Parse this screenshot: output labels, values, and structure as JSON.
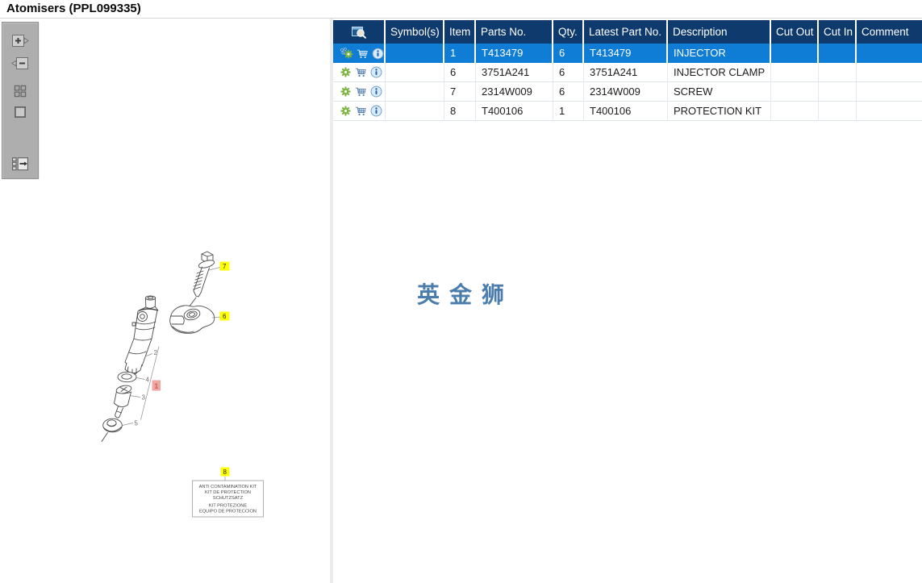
{
  "window": {
    "title": "Atomisers (PPL099335)"
  },
  "toolbar": {
    "buttons": [
      "zoom-in",
      "zoom-out",
      "tile-view",
      "fit-view",
      "toggle-parts-list"
    ]
  },
  "parts_table": {
    "columns": [
      "",
      "Symbol(s)",
      "Item",
      "Parts No.",
      "Qty.",
      "Latest Part No.",
      "Description",
      "Cut Out",
      "Cut In",
      "Comment"
    ],
    "header_icon": "preview-search-icon",
    "row_icons": [
      "gear-icon",
      "cart-icon",
      "info-icon"
    ],
    "selected_row_icons": [
      "symbol-gear-icon",
      "cart-icon",
      "info-icon"
    ],
    "rows": [
      {
        "item": "1",
        "parts_no": "T413479",
        "qty": "6",
        "latest_part_no": "T413479",
        "description": "INJECTOR",
        "symbols": "",
        "cut_out": "",
        "cut_in": "",
        "comment": "",
        "selected": true
      },
      {
        "item": "6",
        "parts_no": "3751A241",
        "qty": "6",
        "latest_part_no": "3751A241",
        "description": "INJECTOR CLAMP",
        "symbols": "",
        "cut_out": "",
        "cut_in": "",
        "comment": "",
        "selected": false
      },
      {
        "item": "7",
        "parts_no": "2314W009",
        "qty": "6",
        "latest_part_no": "2314W009",
        "description": "SCREW",
        "symbols": "",
        "cut_out": "",
        "cut_in": "",
        "comment": "",
        "selected": false
      },
      {
        "item": "8",
        "parts_no": "T400106",
        "qty": "1",
        "latest_part_no": "T400106",
        "description": "PROTECTION KIT",
        "symbols": "",
        "cut_out": "",
        "cut_in": "",
        "comment": "",
        "selected": false
      }
    ],
    "colors": {
      "header_bg": "#0E3A6D",
      "header_text": "#FFFFFF",
      "selected_row_bg": "#0F7CD6",
      "gear_green": "#7CB342",
      "info_blue": "#1E62A8"
    }
  },
  "diagram": {
    "callouts": {
      "n1": "1",
      "n2": "2",
      "n3": "3",
      "n4": "4",
      "n5": "5",
      "n6": "6",
      "n7": "7",
      "n8": "8"
    },
    "callout_styles": {
      "selected": "1",
      "highlighted": [
        "6",
        "7",
        "8"
      ],
      "plain": [
        "2",
        "3",
        "4",
        "5"
      ]
    },
    "colors": {
      "highlight_bg": "#FFFF00",
      "selected_bg": "#F1A7A1",
      "selected_text": "#B13A34"
    },
    "kit_box_lines": [
      "ANTI CONTAMINATION KIT",
      "KIT DE PROTECTION",
      "SCHUTZSATZ",
      "KIT PROTEZIONE",
      "EQUIPO DE PROTECCION"
    ]
  },
  "watermark": {
    "text": "英金狮",
    "color": "#4A7CAC"
  }
}
